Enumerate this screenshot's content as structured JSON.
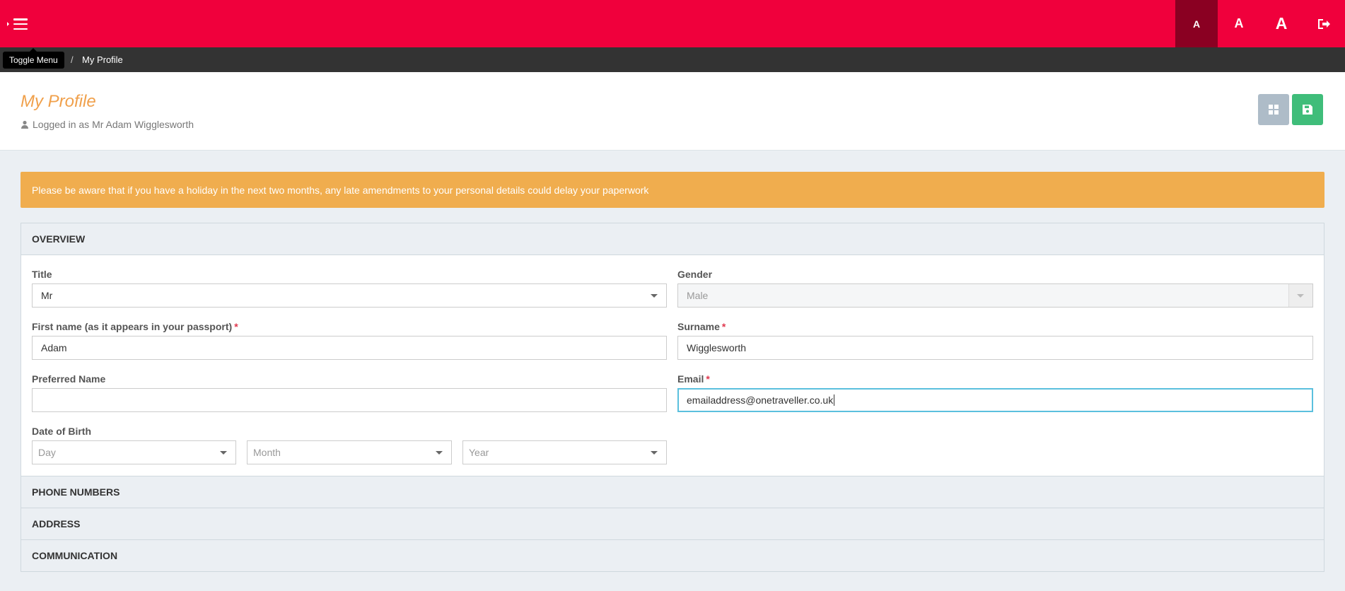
{
  "topbar": {
    "menu_icon": "hamburger-icon",
    "font_sizes": [
      "A",
      "A",
      "A"
    ],
    "logout_icon": "logout-icon",
    "brand_color": "#f0003c"
  },
  "breadcrumb": {
    "tooltip": "Toggle Menu",
    "separator": "/",
    "current": "My Profile"
  },
  "header": {
    "title": "My Profile",
    "logged_in_text": "Logged in as Mr Adam Wigglesworth",
    "user_icon": "user-icon",
    "grid_icon": "dashboard-icon",
    "save_icon": "save-icon"
  },
  "alert": {
    "text": "Please be aware that if you have a holiday in the next two months, any late amendments to your personal details could delay your paperwork"
  },
  "overview": {
    "heading": "OVERVIEW",
    "title_label": "Title",
    "title_value": "Mr",
    "gender_label": "Gender",
    "gender_value": "Male",
    "first_name_label": "First name (as it appears in your passport)",
    "first_name_value": "Adam",
    "surname_label": "Surname",
    "surname_value": "Wigglesworth",
    "preferred_label": "Preferred Name",
    "preferred_value": "",
    "email_label": "Email",
    "email_value": "emailaddress@onetraveller.co.uk",
    "dob_label": "Date of Birth",
    "dob_day": "Day",
    "dob_month": "Month",
    "dob_year": "Year",
    "required_mark": "*"
  },
  "sections": {
    "phone": "PHONE NUMBERS",
    "address": "ADDRESS",
    "communication": "COMMUNICATION"
  }
}
